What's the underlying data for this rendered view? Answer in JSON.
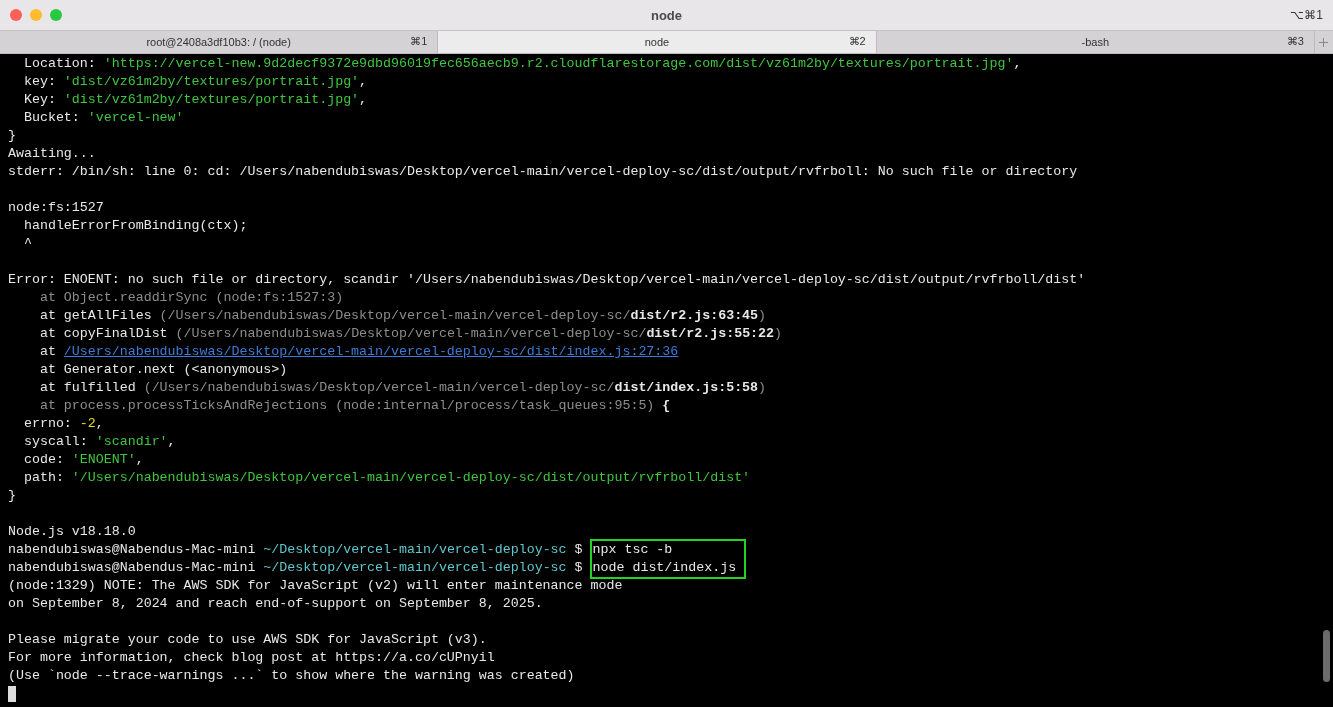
{
  "window": {
    "title": "node",
    "shortcut": "⌥⌘1"
  },
  "tabs": [
    {
      "label": "root@2408a3df10b3: / (node)",
      "shortcut": "⌘1",
      "selected": false
    },
    {
      "label": "node",
      "shortcut": "⌘2",
      "selected": true
    },
    {
      "label": "-bash",
      "shortcut": "⌘3",
      "selected": false
    }
  ],
  "terminal": {
    "lines": [
      {
        "kind": "text",
        "segments": [
          {
            "text": "  Location: ",
            "kind": "plain"
          },
          {
            "text": "'https://vercel-new.9d2decf9372e9dbd96019fec656aecb9.r2.cloudflarestorage.com/dist/vz61m2by/textures/portrait.jpg'",
            "kind": "string"
          },
          {
            "text": ",",
            "kind": "plain"
          }
        ]
      },
      {
        "kind": "text",
        "segments": [
          {
            "text": "  key: ",
            "kind": "plain"
          },
          {
            "text": "'dist/vz61m2by/textures/portrait.jpg'",
            "kind": "string"
          },
          {
            "text": ",",
            "kind": "plain"
          }
        ]
      },
      {
        "kind": "text",
        "segments": [
          {
            "text": "  Key: ",
            "kind": "plain"
          },
          {
            "text": "'dist/vz61m2by/textures/portrait.jpg'",
            "kind": "string"
          },
          {
            "text": ",",
            "kind": "plain"
          }
        ]
      },
      {
        "kind": "text",
        "segments": [
          {
            "text": "  Bucket: ",
            "kind": "plain"
          },
          {
            "text": "'vercel-new'",
            "kind": "string"
          }
        ]
      },
      {
        "kind": "text",
        "segments": [
          {
            "text": "}",
            "kind": "plain"
          }
        ]
      },
      {
        "kind": "text",
        "segments": [
          {
            "text": "Awaiting...",
            "kind": "plain"
          }
        ]
      },
      {
        "kind": "text",
        "segments": [
          {
            "text": "stderr: /bin/sh: line 0: cd: /Users/nabendubiswas/Desktop/vercel-main/vercel-deploy-sc/dist/output/rvfrboll: No such file or directory",
            "kind": "plain"
          }
        ]
      },
      {
        "kind": "blank"
      },
      {
        "kind": "text",
        "segments": [
          {
            "text": "node:fs:1527",
            "kind": "plain"
          }
        ]
      },
      {
        "kind": "text",
        "segments": [
          {
            "text": "  handleErrorFromBinding(ctx);",
            "kind": "plain"
          }
        ]
      },
      {
        "kind": "text",
        "segments": [
          {
            "text": "  ^",
            "kind": "plain"
          }
        ]
      },
      {
        "kind": "blank"
      },
      {
        "kind": "text",
        "segments": [
          {
            "text": "Error: ENOENT: no such file or directory, scandir '/Users/nabendubiswas/Desktop/vercel-main/vercel-deploy-sc/dist/output/rvfrboll/dist'",
            "kind": "plain"
          }
        ]
      },
      {
        "kind": "text",
        "segments": [
          {
            "text": "    at Object.readdirSync (node:fs:1527:3)",
            "kind": "dim"
          }
        ]
      },
      {
        "kind": "text",
        "segments": [
          {
            "text": "    at getAllFiles ",
            "kind": "plain"
          },
          {
            "text": "(/Users/nabendubiswas/Desktop/vercel-main/vercel-deploy-sc/",
            "kind": "dim"
          },
          {
            "text": "dist/r2.js:63:45",
            "kind": "plain"
          },
          {
            "text": ")",
            "kind": "dim"
          }
        ]
      },
      {
        "kind": "text",
        "segments": [
          {
            "text": "    at copyFinalDist ",
            "kind": "plain"
          },
          {
            "text": "(/Users/nabendubiswas/Desktop/vercel-main/vercel-deploy-sc/",
            "kind": "dim"
          },
          {
            "text": "dist/r2.js:55:22",
            "kind": "plain"
          },
          {
            "text": ")",
            "kind": "dim"
          }
        ]
      },
      {
        "kind": "text",
        "segments": [
          {
            "text": "    at ",
            "kind": "plain"
          },
          {
            "text": "/Users/nabendubiswas/Desktop/vercel-main/vercel-deploy-sc/dist/index.js:27:36",
            "kind": "link"
          }
        ]
      },
      {
        "kind": "text",
        "segments": [
          {
            "text": "    at Generator.next (<anonymous>)",
            "kind": "plain"
          }
        ]
      },
      {
        "kind": "text",
        "segments": [
          {
            "text": "    at fulfilled ",
            "kind": "plain"
          },
          {
            "text": "(/Users/nabendubiswas/Desktop/vercel-main/vercel-deploy-sc/",
            "kind": "dim"
          },
          {
            "text": "dist/index.js:5:58",
            "kind": "plain"
          },
          {
            "text": ")",
            "kind": "dim"
          }
        ]
      },
      {
        "kind": "text",
        "segments": [
          {
            "text": "    at process.processTicksAndRejections (node:internal/process/task_queues:95:5)",
            "kind": "dim"
          },
          {
            "text": " {",
            "kind": "plain"
          }
        ]
      },
      {
        "kind": "text",
        "segments": [
          {
            "text": "  errno: ",
            "kind": "plain"
          },
          {
            "text": "-2",
            "kind": "number"
          },
          {
            "text": ",",
            "kind": "plain"
          }
        ]
      },
      {
        "kind": "text",
        "segments": [
          {
            "text": "  syscall: ",
            "kind": "plain"
          },
          {
            "text": "'scandir'",
            "kind": "string"
          },
          {
            "text": ",",
            "kind": "plain"
          }
        ]
      },
      {
        "kind": "text",
        "segments": [
          {
            "text": "  code: ",
            "kind": "plain"
          },
          {
            "text": "'ENOENT'",
            "kind": "string"
          },
          {
            "text": ",",
            "kind": "plain"
          }
        ]
      },
      {
        "kind": "text",
        "segments": [
          {
            "text": "  path: ",
            "kind": "plain"
          },
          {
            "text": "'/Users/nabendubiswas/Desktop/vercel-main/vercel-deploy-sc/dist/output/rvfrboll/dist'",
            "kind": "string"
          }
        ]
      },
      {
        "kind": "text",
        "segments": [
          {
            "text": "}",
            "kind": "plain"
          }
        ]
      },
      {
        "kind": "blank"
      },
      {
        "kind": "text",
        "segments": [
          {
            "text": "Node.js v18.18.0",
            "kind": "plain"
          }
        ]
      },
      {
        "kind": "prompt",
        "user": "nabendubiswas@Nabendus-Mac-mini",
        "cwd": "~/Desktop/vercel-main/vercel-deploy-sc",
        "symbol": "$",
        "command": "npx tsc -b",
        "highlighted": true
      },
      {
        "kind": "prompt",
        "user": "nabendubiswas@Nabendus-Mac-mini",
        "cwd": "~/Desktop/vercel-main/vercel-deploy-sc",
        "symbol": "$",
        "command": "node dist/index.js",
        "highlighted": true
      },
      {
        "kind": "text",
        "segments": [
          {
            "text": "(node:1329) NOTE: The AWS SDK for JavaScript (v2) will enter maintenance mode",
            "kind": "plain"
          }
        ]
      },
      {
        "kind": "text",
        "segments": [
          {
            "text": "on September 8, 2024 and reach end-of-support on September 8, 2025.",
            "kind": "plain"
          }
        ]
      },
      {
        "kind": "blank"
      },
      {
        "kind": "text",
        "segments": [
          {
            "text": "Please migrate your code to use AWS SDK for JavaScript (v3).",
            "kind": "plain"
          }
        ]
      },
      {
        "kind": "text",
        "segments": [
          {
            "text": "For more information, check blog post at https://a.co/cUPnyil",
            "kind": "plain"
          }
        ]
      },
      {
        "kind": "text",
        "segments": [
          {
            "text": "(Use `node --trace-warnings ...` to show where the warning was created)",
            "kind": "plain"
          }
        ]
      },
      {
        "kind": "cursor"
      }
    ]
  }
}
